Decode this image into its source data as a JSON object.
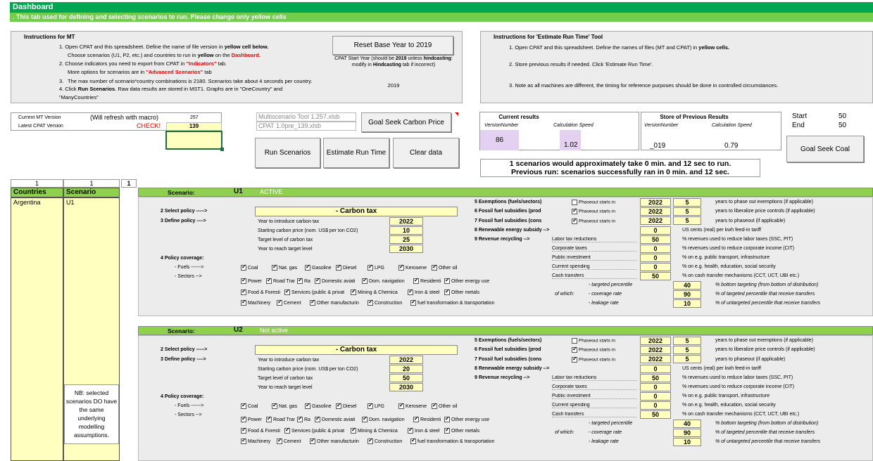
{
  "header": {
    "title": "Dashboard",
    "subtitle": ". This tab used for defining and selecting scenarios to run. Please change only yellow cells"
  },
  "instructions_mt": {
    "title": "Instructions for MT",
    "step1a": "1. Open CPAT and this spreadsheet. Define the name of file version in ",
    "step1b": "yellow cell below.",
    "step1c": "Choose scenarios (U1, P2, etc.) and countries to run in ",
    "step1d": "yellow",
    "step1e": " on the ",
    "step1f": "Dashboard.",
    "step2a": "2. Choose indicators you need to export from CPAT in ",
    "step2b": "\"Indicators\"",
    "step2c": " tab.",
    "step2d": "More options for scenarios are in ",
    "step2e": "\"Advanced Scenarios\"",
    "step2f": " tab",
    "step3num": "3.",
    "step3": "The max number of scenario*country combinations is 2180. Scenarios take about 4 seconds per country.",
    "step4a": "4. Click ",
    "step4b": "Run Scenarios",
    "step4c": ". Raw data results are stored in MST1. Graphs are in \"OneCountry\" and \"ManyCountries\""
  },
  "base_year": {
    "button": "Reset Base Year to 2019",
    "note1": "CPAT Start Year (should be ",
    "note_bold": "2019",
    "note2": " unless ",
    "note3": "hindcasting",
    "note4": ": modify in ",
    "note5": "Hindcasting",
    "note6": " tab if incorrect)",
    "value": "2019"
  },
  "instructions_ert": {
    "title": "Instructions for 'Estimate Run Time' Tool",
    "s1a": "1. Open CPAT and this spreadsheet. Define the names of files (MT and CPAT) in ",
    "s1b": "yellow cells.",
    "s2": "2. Store previous results if needed. Click 'Estimate Run Time'.",
    "s3": "3. Note as all machines are different, the timing for reference purposes should be done in controlled circumstances."
  },
  "versions": {
    "mt_label": "Current MT Version",
    "refresh": "(Will refresh with macro)",
    "mt_value": "257",
    "cpat_label": "Latest CPAT Version",
    "check": "CHECK!",
    "cpat_value": "139"
  },
  "files": {
    "mt_file": "Multiscenario Tool 1.257.xlsb",
    "cpat_file": "CPAT 1.0pre_139.xlsb"
  },
  "buttons": {
    "goal_seek_price": "Goal Seek Carbon Price",
    "run": "Run Scenarios",
    "estimate": "Estimate Run Time",
    "clear": "Clear data",
    "goal_seek_coal": "Goal Seek Coal"
  },
  "current_results": {
    "title": "Current results",
    "col1": "VersionNumber",
    "col2": "Calculation Speed",
    "v1": "86",
    "v2": "1.02"
  },
  "previous_results": {
    "title": "Store of Previous Results",
    "col1": "VersionNumber",
    "col2": "Calculation Speed",
    "v1": "_019",
    "v2": "0.79"
  },
  "start_end": {
    "start_label": "Start",
    "start_value": "50",
    "end_label": "End",
    "end_value": "50"
  },
  "run_msg": {
    "line1": "1 scenarios would approximately take 0 min. and 12 sec to run.",
    "line2": "Previous run: scenarios successfully ran in 0 min. and 12 sec."
  },
  "left_table": {
    "n1": "1",
    "n2": "1",
    "n3": "1",
    "col_countries": "Countries",
    "col_scenario": "Scenario",
    "country": "Argentina",
    "scenario": "U1",
    "nb": "NB: selected scenarios DO have the same underlying modelling assumptions."
  },
  "common": {
    "select_policy": "2  Select policy ----->",
    "define_policy": "3  Define policy ---->",
    "policy_coverage": "4  Policy coverage:",
    "fuels": "- Fuels ------>",
    "sectors": "- Sectors -->",
    "year_intro": "Year to introduce carbon tax",
    "start_price": "Starting carbon price (nom. US$ per ton CO2)",
    "target_level": "Target level of carbon tax",
    "year_target": "Year to reach target level",
    "ex5": "5  Exemptions (fuels/sectors)",
    "ex6": "6  Fossil fuel subsidies (prod",
    "ex7": "7  Fossil fuel subsidies (cons",
    "ex8": "8  Renewable energy subsidy -->",
    "ex9": "9  Revenue recycling -->",
    "phaseout": "Phaseout starts in",
    "desc5": "years to phase out exemptions (if applicable)",
    "desc6": "years to liberalize price controls (if applicable)",
    "desc7": "years to phaseout (if applicable)",
    "desc8": "US cents (real) per kwh feed-in tariff",
    "rr1": "Labor tax reductions",
    "rr2": "Corporate taxes",
    "rr3": "Public investment",
    "rr4": "Current spending",
    "rr5": "Cash transfers",
    "rd1": "% revenues used to reduce labor taxes (SSC, PIT)",
    "rd2": "% revenues used to reduce corporate income (CIT)",
    "rd3": "% on e.g. public transport, infrastructure",
    "rd4": "% on e.g. health, education, social security",
    "rd5": "% on cash transfer mechanisms (CCT, UCT, UBI etc.)",
    "of_which": "of which:",
    "w1": "- targeted percentile",
    "w2": "- coverage rate",
    "w3": "- leakage rate",
    "wd1": "% bottom targeting (from bottom of distribution)",
    "wd2": "% of targeted percentile that receive transfers",
    "wd3": "% of untargeted percentile that receive transfers",
    "f_coal": "Coal",
    "f_natgas": "Nat. gas",
    "f_gasoline": "Gasoline",
    "f_diesel": "Diesel",
    "f_lpg": "LPG",
    "f_kerosene": "Kerosene",
    "f_otheroil": "Other oil",
    "s_power": "Power",
    "s_road": "Road Trar",
    "s_rail": "Ra",
    "s_domav": "Domestic aviati",
    "s_domnav": "Dom. navigation",
    "s_resid": "Residenti",
    "s_otherenergy": "Other energy use",
    "s_food": "Food & Foresti",
    "s_services": "Services (public & privat",
    "s_mining": "Mining & Chemica",
    "s_iron": "Iron & steel",
    "s_othermetals": "Other metals",
    "s_machinery": "Machinery",
    "s_cement": "Cement",
    "s_othermanuf": "Other manufacturin",
    "s_construction": "Construction",
    "s_fueltransf": "fuel transformation & transportation"
  },
  "scenario1": {
    "label": "Scenario:",
    "name": "U1",
    "status": "ACTIVE",
    "policy": "- Carbon tax",
    "year_intro": "2022",
    "start_price": "10",
    "target": "25",
    "year_target": "2030",
    "y5": "2022",
    "n5": "5",
    "y6": "2022",
    "n6": "5",
    "y7": "2022",
    "n7": "5",
    "v8": "0",
    "r1": "50",
    "r2": "0",
    "r3": "0",
    "r4": "0",
    "r5": "50",
    "w1": "40",
    "w2": "90",
    "w3": "10"
  },
  "scenario2": {
    "label": "Scenario:",
    "name": "U2",
    "status": "Not active",
    "policy": "- Carbon tax",
    "year_intro": "2022",
    "start_price": "20",
    "target": "50",
    "year_target": "2030",
    "y5": "2022",
    "n5": "5",
    "y6": "2022",
    "n6": "5",
    "y7": "2022",
    "n7": "5",
    "v8": "0",
    "r1": "50",
    "r2": "0",
    "r3": "0",
    "r4": "0",
    "r5": "50",
    "w1": "40",
    "w2": "90",
    "w3": "10"
  },
  "colors": {
    "dark_green": "#00a651",
    "light_green": "#6fce4a",
    "yellow": "#ffffc0",
    "lavender": "#e4d0f0"
  }
}
